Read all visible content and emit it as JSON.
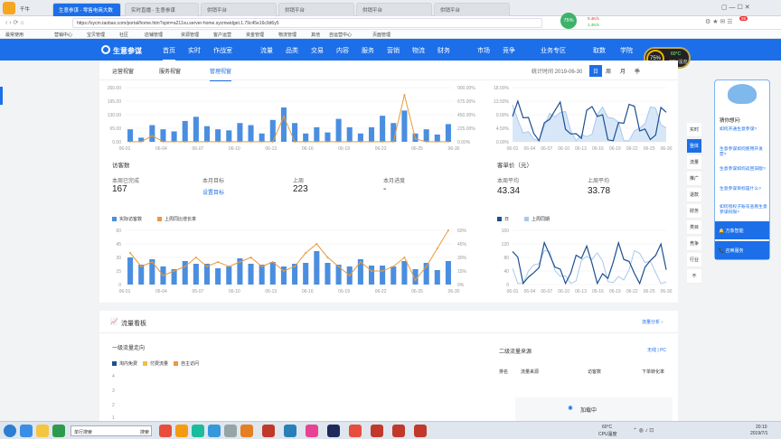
{
  "browser": {
    "tabs": [
      "千牛",
      "生意参谋 - 零售电商大数",
      "实时直播 - 生意参谋",
      "供销平台",
      "供销平台",
      "供销平台",
      "供销平台"
    ],
    "url": "https://sycm.taobao.com/portal/home.htm?spm=a211vu.server-home.sycmwidget.1.79c45e16c9d6y5",
    "perf": {
      "cpu": "75%",
      "up": "0.4K/s",
      "down": "1.4K/s",
      "badge": "99"
    }
  },
  "bookmarks": [
    "最常使用",
    "营销中心",
    "宝贝管理",
    "社区",
    "店铺管理",
    "资源管理",
    "客户运营",
    "资金管理",
    "物流管理",
    "其他",
    "自运营中心",
    "页面管理"
  ],
  "nav": {
    "logo": "生意参谋",
    "items": [
      "首页",
      "实时",
      "作战室",
      "流量",
      "品类",
      "交易",
      "内容",
      "服务",
      "营销",
      "物流",
      "财务",
      "市场",
      "竞争",
      "业务专区",
      "取数",
      "学院"
    ],
    "cpu": "75%",
    "temp": "60°C",
    "temp_label": "CPU温度"
  },
  "toolbar": {
    "tabs": [
      "运营视窗",
      "服务视窗",
      "管理视窗"
    ],
    "stat_time": "统计时间 2019-06-30",
    "periods": [
      "日",
      "周",
      "月",
      "季"
    ]
  },
  "visitors": {
    "title": "访客数",
    "stats": [
      {
        "label": "本周已完成",
        "value": "167"
      },
      {
        "label": "本月目标",
        "value": "设置目标"
      },
      {
        "label": "上周",
        "value": "223"
      },
      {
        "label": "本月进度",
        "value": "-"
      }
    ],
    "legend": [
      "实际访客数",
      "上周同比增长率"
    ]
  },
  "price": {
    "title": "客单价（元）",
    "stats": [
      {
        "label": "本周平均",
        "value": "43.34"
      },
      {
        "label": "上周平均",
        "value": "33.78"
      }
    ],
    "legend": [
      "日",
      "上周同期"
    ]
  },
  "chart_data": [
    {
      "type": "bar",
      "title": "",
      "categories": [
        "06-01",
        "06-02",
        "06-03",
        "06-04",
        "06-05",
        "06-06",
        "06-07",
        "06-08",
        "06-09",
        "06-10",
        "06-11",
        "06-12",
        "06-13",
        "06-14",
        "06-15",
        "06-16",
        "06-17",
        "06-18",
        "06-19",
        "06-20",
        "06-21",
        "06-22",
        "06-23",
        "06-24",
        "06-25",
        "06-26",
        "06-27",
        "06-28",
        "06-29",
        "06-30"
      ],
      "series": [
        {
          "values": [
            60,
            20,
            80,
            60,
            50,
            100,
            120,
            75,
            60,
            55,
            90,
            80,
            40,
            105,
            165,
            90,
            40,
            70,
            45,
            110,
            70,
            40,
            70,
            125,
            90,
            150,
            40,
            60,
            35,
            85
          ]
        },
        {
          "values": [
            1,
            1,
            100,
            1,
            1,
            1,
            1,
            1,
            1,
            1,
            1,
            1,
            1,
            1,
            420,
            1,
            1,
            1,
            1,
            1,
            1,
            1,
            1,
            1,
            1,
            780,
            50,
            1,
            1,
            1
          ]
        }
      ],
      "ylim": [
        0,
        260
      ],
      "y2lim": [
        0,
        900
      ]
    },
    {
      "type": "line",
      "title": "",
      "categories": [
        "06-01",
        "06-04",
        "06-07",
        "06-10",
        "06-13",
        "06-16",
        "06-19",
        "06-22",
        "06-25",
        "06-30"
      ],
      "ylim": [
        0,
        18
      ]
    },
    {
      "type": "bar",
      "title": "",
      "categories": [
        "06-01",
        "06-02",
        "06-03",
        "06-04",
        "06-05",
        "06-06",
        "06-07",
        "06-08",
        "06-09",
        "06-10",
        "06-11",
        "06-12",
        "06-13",
        "06-14",
        "06-15",
        "06-16",
        "06-17",
        "06-18",
        "06-19",
        "06-20",
        "06-21",
        "06-22",
        "06-23",
        "06-24",
        "06-25",
        "06-26",
        "06-27",
        "06-28",
        "06-29",
        "06-30"
      ],
      "series": [
        {
          "name": "实际访客数",
          "values": [
            30,
            22,
            28,
            20,
            17,
            26,
            23,
            23,
            18,
            20,
            29,
            23,
            22,
            25,
            20,
            23,
            24,
            37,
            24,
            22,
            20,
            28,
            21,
            21,
            20,
            26,
            17,
            24,
            16,
            26
          ]
        },
        {
          "name": "上周同比增长率",
          "values": [
            35,
            20,
            25,
            10,
            15,
            20,
            30,
            20,
            25,
            20,
            25,
            30,
            20,
            25,
            15,
            20,
            35,
            45,
            30,
            20,
            10,
            25,
            15,
            15,
            20,
            30,
            5,
            20,
            40,
            60
          ]
        }
      ],
      "ylim": [
        0,
        60
      ]
    },
    {
      "type": "line",
      "title": "",
      "categories": [
        "06-01",
        "06-04",
        "06-07",
        "06-10",
        "06-13",
        "06-16",
        "06-19",
        "06-22",
        "06-25",
        "06-30"
      ],
      "series": [
        {
          "name": "日"
        },
        {
          "name": "上周同期"
        }
      ],
      "ylim": [
        0,
        160
      ]
    }
  ],
  "axis": {
    "top_left_y": [
      "260.00",
      "195.00",
      "130.00",
      "65.00",
      "0.00"
    ],
    "top_left_y2": [
      "900.00%",
      "675.00%",
      "450.00%",
      "225.00%",
      "0.00%"
    ],
    "top_right_y": [
      "18.00%",
      "13.50%",
      "9.00%",
      "4.50%",
      "0.00%"
    ],
    "mid_left_y": [
      "60",
      "45",
      "30",
      "15",
      "0"
    ],
    "mid_left_y2": [
      "60%",
      "45%",
      "30%",
      "15%",
      "0%"
    ],
    "mid_right_y": [
      "160",
      "120",
      "80",
      "40",
      "0"
    ],
    "x_labels": [
      "06-01",
      "06-04",
      "06-07",
      "06-10",
      "06-13",
      "06-16",
      "06-19",
      "06-22",
      "06-25",
      "06-30"
    ]
  },
  "flow": {
    "title": "流量看板",
    "link": "流量分析 ›",
    "first_title": "一级流量走向",
    "legend": [
      "淘内免费",
      "付费流量",
      "自主访问"
    ],
    "y": [
      "4",
      "3",
      "2",
      "1"
    ],
    "second_title": "二级流量来源",
    "mode": "无线 | PC",
    "cols": [
      "排名",
      "流量来源",
      "访客数",
      "下单转化率"
    ],
    "loading": "加载中"
  },
  "sidebar": [
    "实时",
    "整体",
    "流量",
    "推广",
    "退款",
    "财务",
    "类目",
    "竞争",
    "行业",
    "不"
  ],
  "help": {
    "title": "猜你想问:",
    "items": [
      "如何开通生意参谋?",
      "生意参谋如何使用开发票?",
      "生意参谋如何返回旧版?",
      "生意参谋目标是什么?",
      "如何授权子账号查看生意参谋权限?"
    ],
    "btn1": "万象智能",
    "btn2": "召唤服务"
  },
  "taskbar": {
    "search": "单行搜索",
    "btn": "搜索",
    "temp": "60°C",
    "temp_label": "CPU温度",
    "time": "20:10",
    "date": "2019/7/1"
  }
}
